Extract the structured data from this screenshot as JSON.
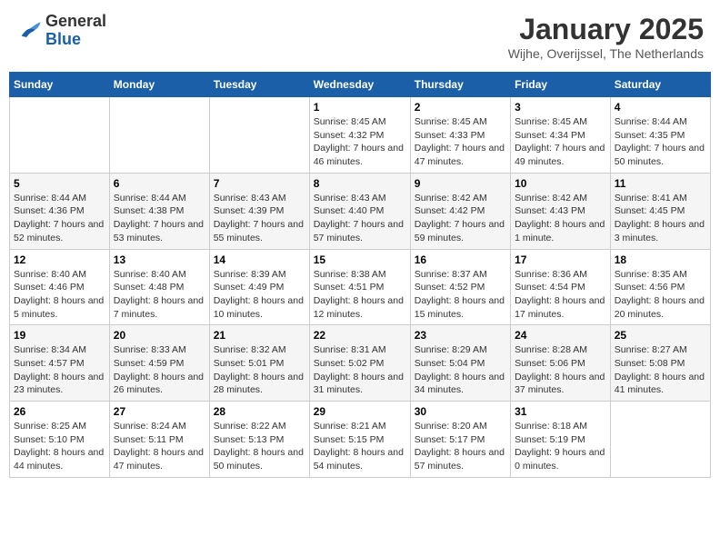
{
  "header": {
    "logo_line1": "General",
    "logo_line2": "Blue",
    "month": "January 2025",
    "location": "Wijhe, Overijssel, The Netherlands"
  },
  "weekdays": [
    "Sunday",
    "Monday",
    "Tuesday",
    "Wednesday",
    "Thursday",
    "Friday",
    "Saturday"
  ],
  "weeks": [
    [
      {
        "day": "",
        "info": ""
      },
      {
        "day": "",
        "info": ""
      },
      {
        "day": "",
        "info": ""
      },
      {
        "day": "1",
        "info": "Sunrise: 8:45 AM\nSunset: 4:32 PM\nDaylight: 7 hours and 46 minutes."
      },
      {
        "day": "2",
        "info": "Sunrise: 8:45 AM\nSunset: 4:33 PM\nDaylight: 7 hours and 47 minutes."
      },
      {
        "day": "3",
        "info": "Sunrise: 8:45 AM\nSunset: 4:34 PM\nDaylight: 7 hours and 49 minutes."
      },
      {
        "day": "4",
        "info": "Sunrise: 8:44 AM\nSunset: 4:35 PM\nDaylight: 7 hours and 50 minutes."
      }
    ],
    [
      {
        "day": "5",
        "info": "Sunrise: 8:44 AM\nSunset: 4:36 PM\nDaylight: 7 hours and 52 minutes."
      },
      {
        "day": "6",
        "info": "Sunrise: 8:44 AM\nSunset: 4:38 PM\nDaylight: 7 hours and 53 minutes."
      },
      {
        "day": "7",
        "info": "Sunrise: 8:43 AM\nSunset: 4:39 PM\nDaylight: 7 hours and 55 minutes."
      },
      {
        "day": "8",
        "info": "Sunrise: 8:43 AM\nSunset: 4:40 PM\nDaylight: 7 hours and 57 minutes."
      },
      {
        "day": "9",
        "info": "Sunrise: 8:42 AM\nSunset: 4:42 PM\nDaylight: 7 hours and 59 minutes."
      },
      {
        "day": "10",
        "info": "Sunrise: 8:42 AM\nSunset: 4:43 PM\nDaylight: 8 hours and 1 minute."
      },
      {
        "day": "11",
        "info": "Sunrise: 8:41 AM\nSunset: 4:45 PM\nDaylight: 8 hours and 3 minutes."
      }
    ],
    [
      {
        "day": "12",
        "info": "Sunrise: 8:40 AM\nSunset: 4:46 PM\nDaylight: 8 hours and 5 minutes."
      },
      {
        "day": "13",
        "info": "Sunrise: 8:40 AM\nSunset: 4:48 PM\nDaylight: 8 hours and 7 minutes."
      },
      {
        "day": "14",
        "info": "Sunrise: 8:39 AM\nSunset: 4:49 PM\nDaylight: 8 hours and 10 minutes."
      },
      {
        "day": "15",
        "info": "Sunrise: 8:38 AM\nSunset: 4:51 PM\nDaylight: 8 hours and 12 minutes."
      },
      {
        "day": "16",
        "info": "Sunrise: 8:37 AM\nSunset: 4:52 PM\nDaylight: 8 hours and 15 minutes."
      },
      {
        "day": "17",
        "info": "Sunrise: 8:36 AM\nSunset: 4:54 PM\nDaylight: 8 hours and 17 minutes."
      },
      {
        "day": "18",
        "info": "Sunrise: 8:35 AM\nSunset: 4:56 PM\nDaylight: 8 hours and 20 minutes."
      }
    ],
    [
      {
        "day": "19",
        "info": "Sunrise: 8:34 AM\nSunset: 4:57 PM\nDaylight: 8 hours and 23 minutes."
      },
      {
        "day": "20",
        "info": "Sunrise: 8:33 AM\nSunset: 4:59 PM\nDaylight: 8 hours and 26 minutes."
      },
      {
        "day": "21",
        "info": "Sunrise: 8:32 AM\nSunset: 5:01 PM\nDaylight: 8 hours and 28 minutes."
      },
      {
        "day": "22",
        "info": "Sunrise: 8:31 AM\nSunset: 5:02 PM\nDaylight: 8 hours and 31 minutes."
      },
      {
        "day": "23",
        "info": "Sunrise: 8:29 AM\nSunset: 5:04 PM\nDaylight: 8 hours and 34 minutes."
      },
      {
        "day": "24",
        "info": "Sunrise: 8:28 AM\nSunset: 5:06 PM\nDaylight: 8 hours and 37 minutes."
      },
      {
        "day": "25",
        "info": "Sunrise: 8:27 AM\nSunset: 5:08 PM\nDaylight: 8 hours and 41 minutes."
      }
    ],
    [
      {
        "day": "26",
        "info": "Sunrise: 8:25 AM\nSunset: 5:10 PM\nDaylight: 8 hours and 44 minutes."
      },
      {
        "day": "27",
        "info": "Sunrise: 8:24 AM\nSunset: 5:11 PM\nDaylight: 8 hours and 47 minutes."
      },
      {
        "day": "28",
        "info": "Sunrise: 8:22 AM\nSunset: 5:13 PM\nDaylight: 8 hours and 50 minutes."
      },
      {
        "day": "29",
        "info": "Sunrise: 8:21 AM\nSunset: 5:15 PM\nDaylight: 8 hours and 54 minutes."
      },
      {
        "day": "30",
        "info": "Sunrise: 8:20 AM\nSunset: 5:17 PM\nDaylight: 8 hours and 57 minutes."
      },
      {
        "day": "31",
        "info": "Sunrise: 8:18 AM\nSunset: 5:19 PM\nDaylight: 9 hours and 0 minutes."
      },
      {
        "day": "",
        "info": ""
      }
    ]
  ]
}
